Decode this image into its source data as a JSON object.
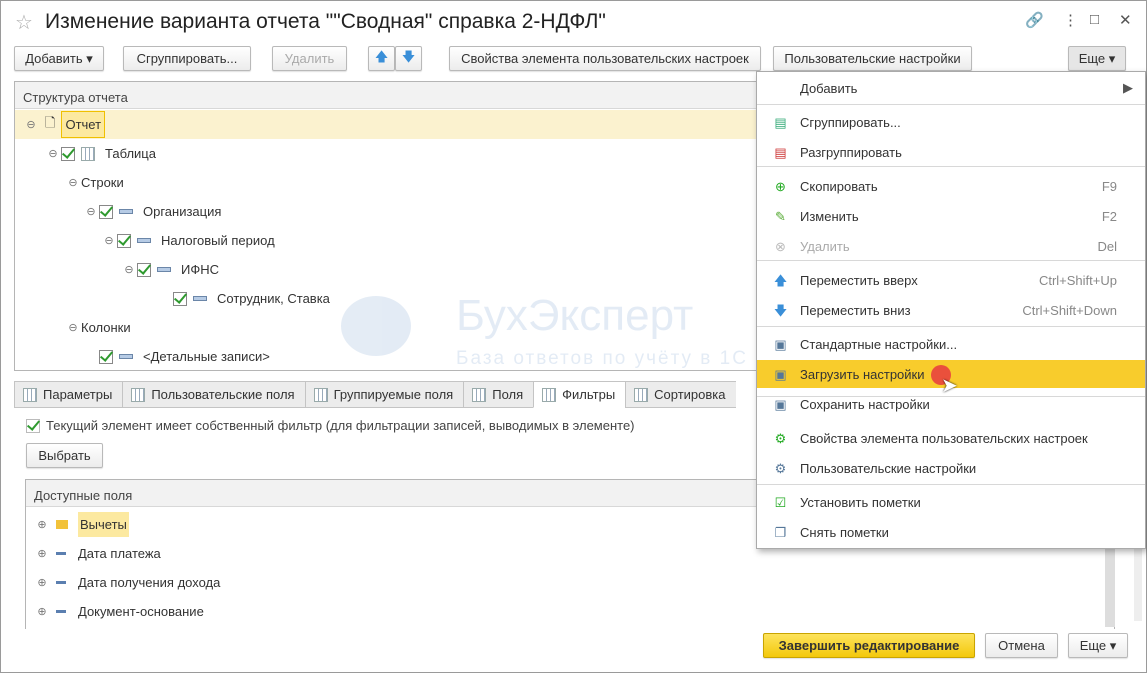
{
  "window": {
    "title": "Изменение варианта отчета \"\"Сводная\" справка 2-НДФЛ\""
  },
  "toolbar": {
    "add": "Добавить",
    "group": "Сгруппировать...",
    "delete": "Удалить",
    "item_props": "Свойства элемента пользовательских настроек",
    "user_settings": "Пользовательские настройки",
    "more": "Еще"
  },
  "structure": {
    "header": "Структура отчета",
    "rows": [
      {
        "label": "Отчет",
        "level": 0
      },
      {
        "label": "Таблица",
        "level": 1
      },
      {
        "label": "Строки",
        "level": 2
      },
      {
        "label": "Организация",
        "level": 3
      },
      {
        "label": "Налоговый период",
        "level": 4
      },
      {
        "label": "ИФНС",
        "level": 5
      },
      {
        "label": "Сотрудник, Ставка",
        "level": 6
      },
      {
        "label": "Колонки",
        "level": 2
      },
      {
        "label": "<Детальные записи>",
        "level": 3
      }
    ]
  },
  "tabs": [
    "Параметры",
    "Пользовательские поля",
    "Группируемые поля",
    "Поля",
    "Фильтры",
    "Сортировка"
  ],
  "active_tab": "Фильтры",
  "filters": {
    "own_filter": "Текущий элемент имеет собственный фильтр (для фильтрации записей, выводимых в элементе)",
    "select": "Выбрать",
    "available_header": "Доступные поля",
    "fields": [
      "Вычеты",
      "Дата платежа",
      "Дата получения дохода",
      "Документ-основание"
    ]
  },
  "menu": {
    "items": [
      {
        "label": "Добавить",
        "shortcut": ""
      },
      {
        "label": "Сгруппировать...",
        "shortcut": ""
      },
      {
        "label": "Разгруппировать",
        "shortcut": ""
      },
      {
        "label": "Скопировать",
        "shortcut": "F9"
      },
      {
        "label": "Изменить",
        "shortcut": "F2"
      },
      {
        "label": "Удалить",
        "shortcut": "Del"
      },
      {
        "label": "Переместить вверх",
        "shortcut": "Ctrl+Shift+Up"
      },
      {
        "label": "Переместить вниз",
        "shortcut": "Ctrl+Shift+Down"
      },
      {
        "label": "Стандартные настройки...",
        "shortcut": ""
      },
      {
        "label": "Загрузить настройки",
        "shortcut": ""
      },
      {
        "label": "Сохранить настройки",
        "shortcut": ""
      },
      {
        "label": "Свойства элемента пользовательских настроек",
        "shortcut": ""
      },
      {
        "label": "Пользовательские настройки",
        "shortcut": ""
      },
      {
        "label": "Установить пометки",
        "shortcut": ""
      },
      {
        "label": "Снять пометки",
        "shortcut": ""
      }
    ]
  },
  "footer": {
    "finish": "Завершить редактирование",
    "cancel": "Отмена",
    "more": "Еще"
  },
  "watermark": {
    "brand": "БухЭксперт",
    "subtitle": "База ответов по учёту в 1С"
  },
  "colors": {
    "accent": "#f8cc2c",
    "selection": "#fbf2cf"
  }
}
